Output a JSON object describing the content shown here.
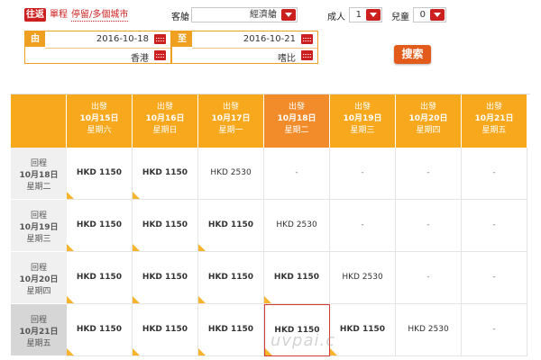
{
  "trip_tabs": {
    "roundtrip": "往返",
    "oneway": "單程",
    "multicity": "停留/多個城市"
  },
  "cabin": {
    "label": "客艙",
    "value": "經濟艙"
  },
  "adults": {
    "label": "成人",
    "value": "1"
  },
  "children": {
    "label": "兒童",
    "value": "0"
  },
  "dates": {
    "from_tag": "由",
    "from_date": "2016-10-18",
    "from_city": "香港",
    "to_tag": "至",
    "to_date": "2016-10-21",
    "to_city": "嗜比"
  },
  "search_button": "搜索",
  "columns": [
    {
      "top": "出發",
      "date": "10月15日",
      "day": "星期六",
      "selected": false
    },
    {
      "top": "出發",
      "date": "10月16日",
      "day": "星期日",
      "selected": false
    },
    {
      "top": "出發",
      "date": "10月17日",
      "day": "星期一",
      "selected": false
    },
    {
      "top": "出發",
      "date": "10月18日",
      "day": "星期二",
      "selected": true
    },
    {
      "top": "出發",
      "date": "10月19日",
      "day": "星期三",
      "selected": false
    },
    {
      "top": "出發",
      "date": "10月20日",
      "day": "星期四",
      "selected": false
    },
    {
      "top": "出發",
      "date": "10月21日",
      "day": "星期五",
      "selected": false
    }
  ],
  "rows": [
    {
      "top": "回程",
      "date": "10月18日",
      "day": "星期二",
      "selected": false,
      "cells": [
        {
          "text": "HKD 1150",
          "bold": true,
          "cheap": true
        },
        {
          "text": "HKD 1150",
          "bold": true,
          "cheap": true
        },
        {
          "text": "HKD 2530",
          "bold": false,
          "cheap": false
        },
        {
          "text": "-",
          "bold": false,
          "cheap": false
        },
        {
          "text": "-",
          "bold": false,
          "cheap": false
        },
        {
          "text": "-",
          "bold": false,
          "cheap": false
        },
        {
          "text": "-",
          "bold": false,
          "cheap": false
        }
      ]
    },
    {
      "top": "回程",
      "date": "10月19日",
      "day": "星期三",
      "selected": false,
      "cells": [
        {
          "text": "HKD 1150",
          "bold": true,
          "cheap": true
        },
        {
          "text": "HKD 1150",
          "bold": true,
          "cheap": true
        },
        {
          "text": "HKD 1150",
          "bold": true,
          "cheap": true
        },
        {
          "text": "HKD 2530",
          "bold": false,
          "cheap": false
        },
        {
          "text": "-",
          "bold": false,
          "cheap": false
        },
        {
          "text": "-",
          "bold": false,
          "cheap": false
        },
        {
          "text": "-",
          "bold": false,
          "cheap": false
        }
      ]
    },
    {
      "top": "回程",
      "date": "10月20日",
      "day": "星期四",
      "selected": false,
      "cells": [
        {
          "text": "HKD 1150",
          "bold": true,
          "cheap": true
        },
        {
          "text": "HKD 1150",
          "bold": true,
          "cheap": true
        },
        {
          "text": "HKD 1150",
          "bold": true,
          "cheap": true
        },
        {
          "text": "HKD 1150",
          "bold": true,
          "cheap": true
        },
        {
          "text": "HKD 2530",
          "bold": false,
          "cheap": false
        },
        {
          "text": "-",
          "bold": false,
          "cheap": false
        },
        {
          "text": "-",
          "bold": false,
          "cheap": false
        }
      ]
    },
    {
      "top": "回程",
      "date": "10月21日",
      "day": "星期五",
      "selected": true,
      "cells": [
        {
          "text": "HKD 1150",
          "bold": true,
          "cheap": true
        },
        {
          "text": "HKD 1150",
          "bold": true,
          "cheap": true
        },
        {
          "text": "HKD 1150",
          "bold": true,
          "cheap": true
        },
        {
          "text": "HKD 1150",
          "bold": true,
          "cheap": true,
          "selected": true
        },
        {
          "text": "HKD 1150",
          "bold": true,
          "cheap": true
        },
        {
          "text": "HKD 2530",
          "bold": false,
          "cheap": false
        },
        {
          "text": "-",
          "bold": false,
          "cheap": false
        }
      ]
    }
  ],
  "watermark": "uvpai.c",
  "colors": {
    "header": "#f8a81c",
    "header_selected": "#f28c2a",
    "accent_red": "#cc1f1f",
    "search_orange": "#e35b1a"
  }
}
